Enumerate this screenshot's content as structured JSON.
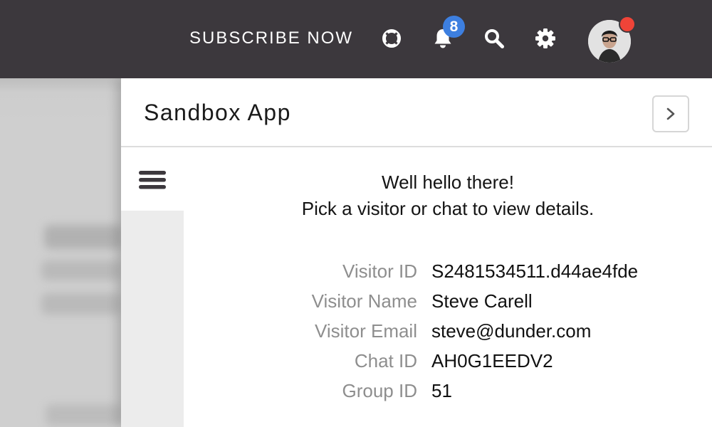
{
  "topbar": {
    "subscribe_label": "SUBSCRIBE NOW",
    "notification_count": "8",
    "icons": [
      "lifebuoy-icon",
      "bell-icon",
      "search-icon",
      "gear-icon"
    ],
    "background_color": "#3c383d",
    "badge_color": "#3d7fe0",
    "presence_dot_color": "#ef4438"
  },
  "panel": {
    "title": "Sandbox App",
    "greeting_line1": "Well hello there!",
    "greeting_line2": "Pick a visitor or chat to view details.",
    "details": [
      {
        "label": "Visitor ID",
        "value": "S2481534511.d44ae4fde"
      },
      {
        "label": "Visitor Name",
        "value": "Steve Carell"
      },
      {
        "label": "Visitor Email",
        "value": "steve@dunder.com"
      },
      {
        "label": "Chat ID",
        "value": "AH0G1EEDV2"
      },
      {
        "label": "Group ID",
        "value": "51"
      }
    ]
  }
}
